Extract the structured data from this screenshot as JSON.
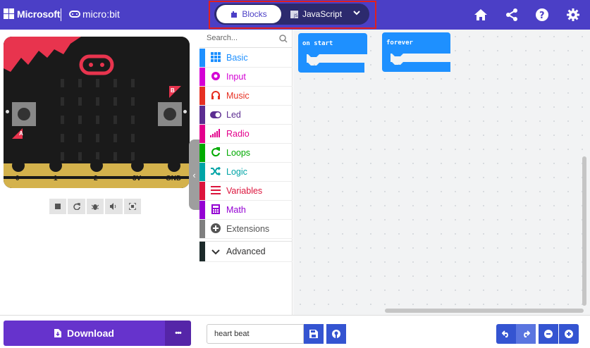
{
  "header": {
    "brand": "Microsoft",
    "product": "micro:bit",
    "tabs": [
      {
        "label": "Blocks",
        "active": true
      },
      {
        "label": "JavaScript",
        "active": false
      }
    ],
    "icons": [
      "home-icon",
      "share-icon",
      "help-icon",
      "settings-icon"
    ],
    "accent_color": "#4b3fc6"
  },
  "simulator": {
    "buttons": [
      "A",
      "B"
    ],
    "pins": [
      "0",
      "1",
      "2",
      "3V",
      "GND"
    ],
    "tools": [
      "stop-icon",
      "restart-icon",
      "debug-icon",
      "sound-icon",
      "fullscreen-icon"
    ]
  },
  "toolbox": {
    "search_placeholder": "Search...",
    "categories": [
      {
        "label": "Basic",
        "color": "#1e90ff"
      },
      {
        "label": "Input",
        "color": "#d400d4"
      },
      {
        "label": "Music",
        "color": "#e63022"
      },
      {
        "label": "Led",
        "color": "#5c2d91"
      },
      {
        "label": "Radio",
        "color": "#e3008c"
      },
      {
        "label": "Loops",
        "color": "#00aa00"
      },
      {
        "label": "Logic",
        "color": "#00a4a6"
      },
      {
        "label": "Variables",
        "color": "#dc143c"
      },
      {
        "label": "Math",
        "color": "#9400d3"
      },
      {
        "label": "Extensions",
        "color": "#7f7f7f"
      }
    ],
    "advanced_label": "Advanced"
  },
  "workspace": {
    "blocks": [
      {
        "label": "on start"
      },
      {
        "label": "forever"
      }
    ]
  },
  "footer": {
    "download_label": "Download",
    "more_label": "•••",
    "project_name": "heart beat"
  }
}
